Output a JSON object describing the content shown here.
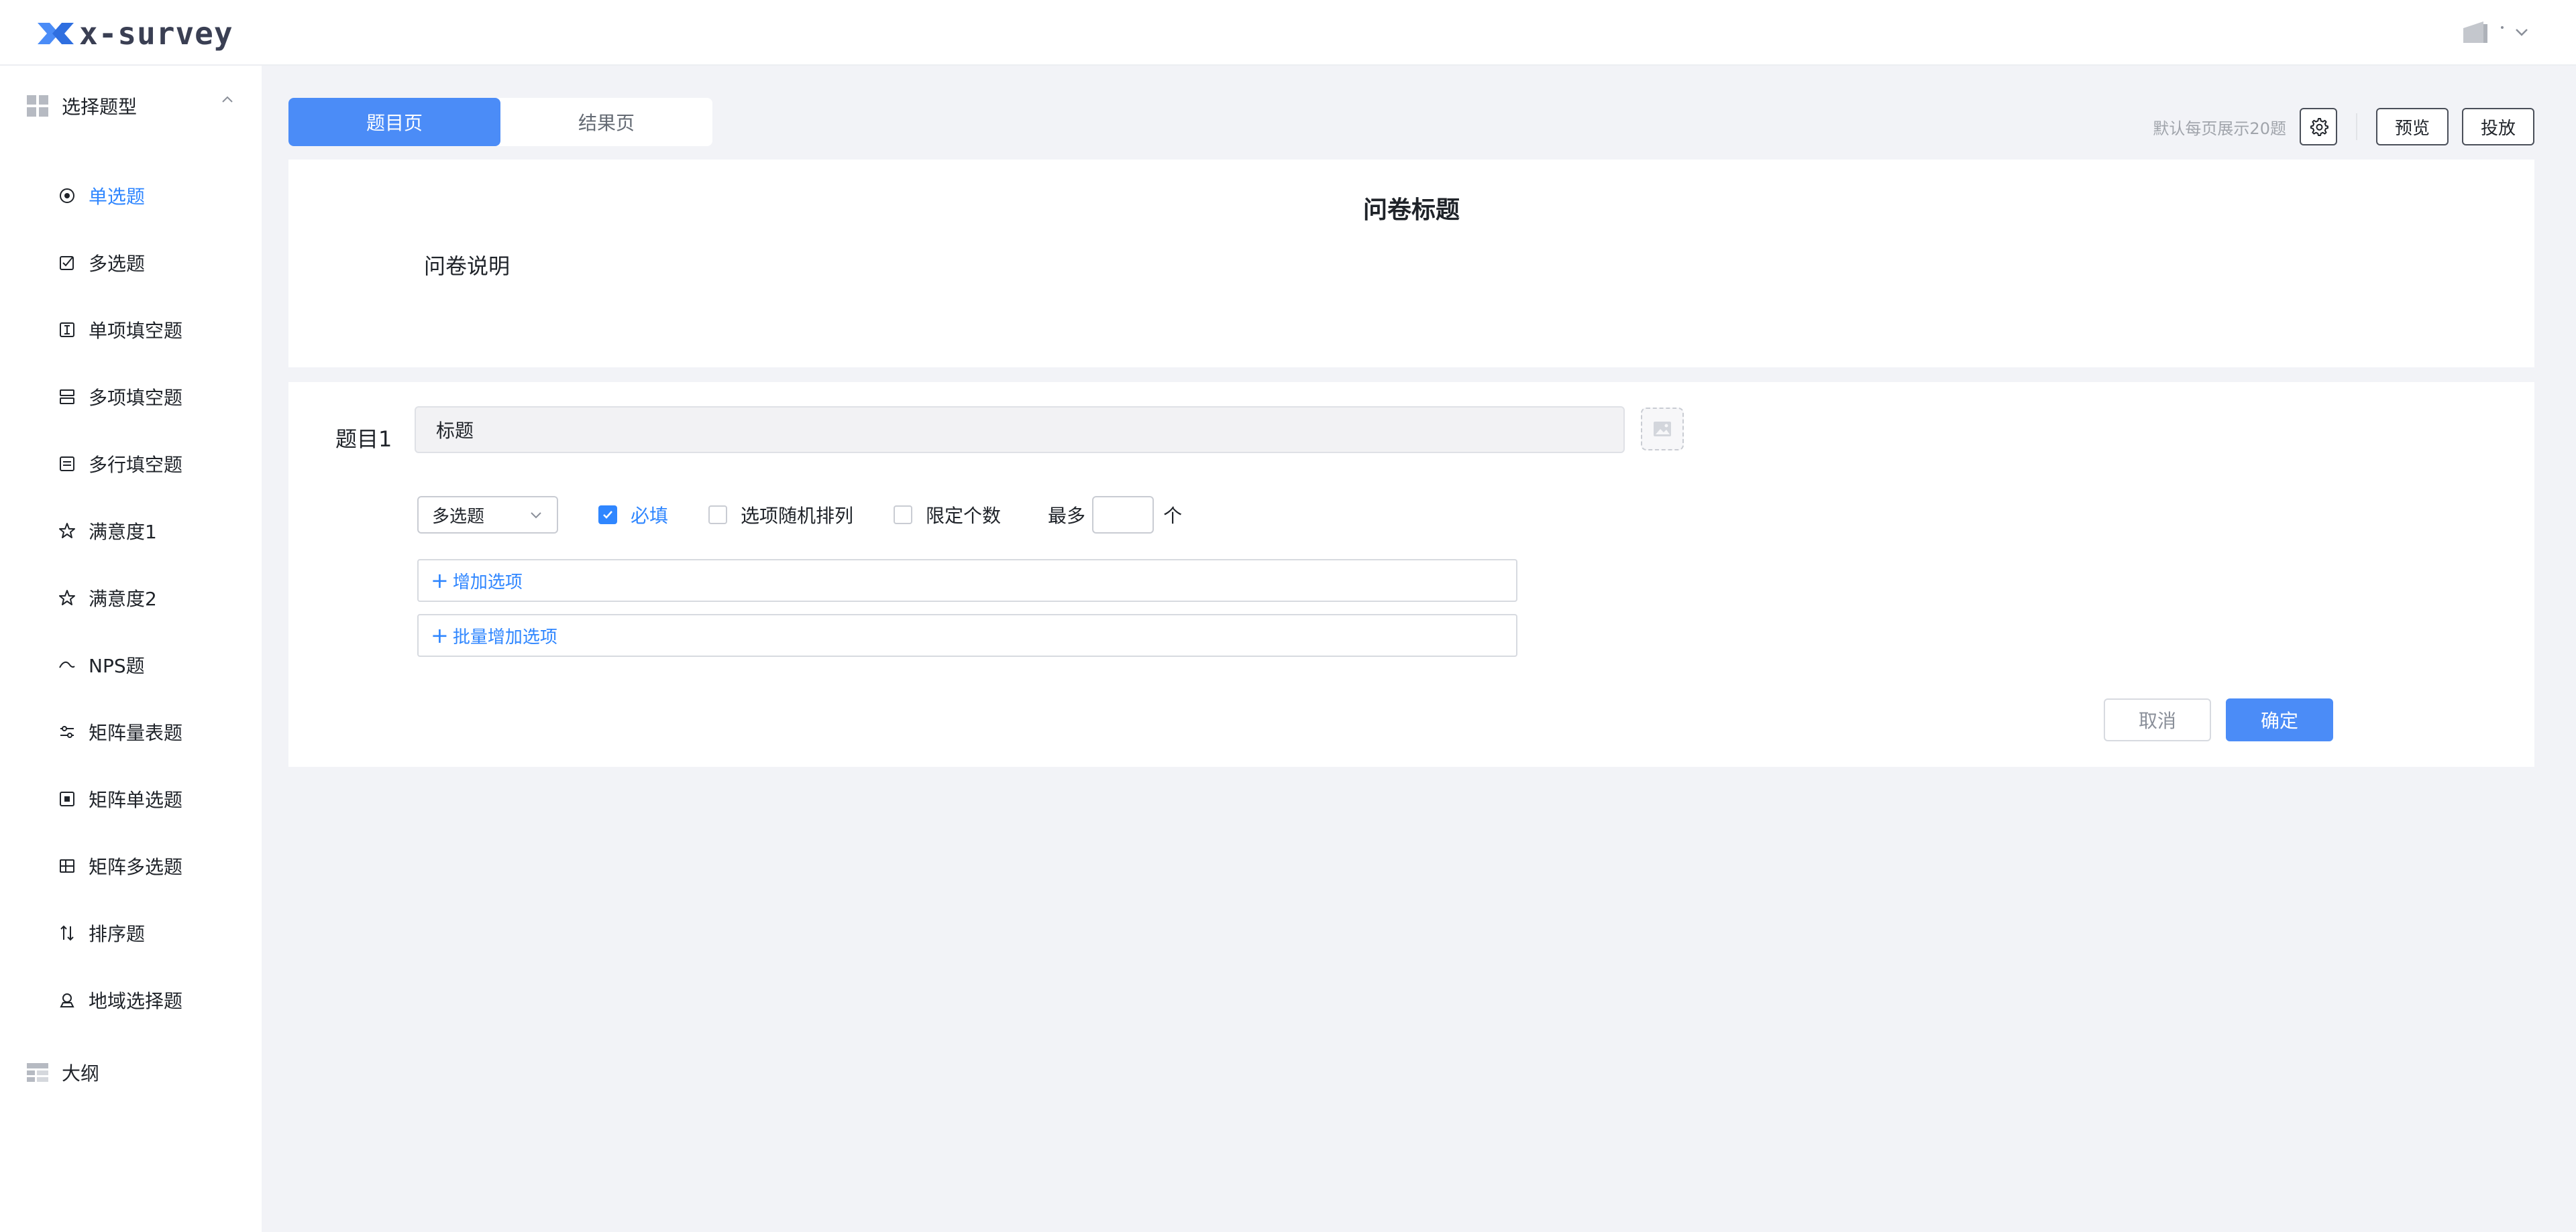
{
  "app": {
    "logo_text": "x-survey"
  },
  "sidebar": {
    "group_question_types": "选择题型",
    "items": [
      {
        "label": "单选题",
        "icon": "radio-icon",
        "active": true
      },
      {
        "label": "多选题",
        "icon": "checkbox-icon"
      },
      {
        "label": "单项填空题",
        "icon": "text-cursor-icon"
      },
      {
        "label": "多项填空题",
        "icon": "multi-field-icon"
      },
      {
        "label": "多行填空题",
        "icon": "textarea-icon"
      },
      {
        "label": "满意度1",
        "icon": "star-icon"
      },
      {
        "label": "满意度2",
        "icon": "star-icon"
      },
      {
        "label": "NPS题",
        "icon": "nps-icon"
      },
      {
        "label": "矩阵量表题",
        "icon": "sliders-icon"
      },
      {
        "label": "矩阵单选题",
        "icon": "matrix-radio-icon"
      },
      {
        "label": "矩阵多选题",
        "icon": "matrix-grid-icon"
      },
      {
        "label": "排序题",
        "icon": "sort-icon"
      },
      {
        "label": "地域选择题",
        "icon": "location-icon"
      }
    ],
    "group_outline": "大纲"
  },
  "tabs": {
    "question_page": "题目页",
    "result_page": "结果页"
  },
  "toolbar": {
    "hint": "默认每页展示20题",
    "preview": "预览",
    "publish": "投放"
  },
  "survey": {
    "title": "问卷标题",
    "description": "问卷说明"
  },
  "question": {
    "label": "题目1",
    "title_value": "标题",
    "type_selected": "多选题",
    "required_label": "必填",
    "required_checked": true,
    "random_order_label": "选项随机排列",
    "random_order_checked": false,
    "limit_count_label": "限定个数",
    "limit_count_checked": false,
    "max_label": "最多",
    "max_value": "",
    "max_unit": "个",
    "add_option": "增加选项",
    "batch_add_option": "批量增加选项",
    "cancel": "取消",
    "confirm": "确定"
  },
  "colors": {
    "accent": "#4b8cf7",
    "link": "#2f86ff",
    "background": "#f2f3f7"
  }
}
